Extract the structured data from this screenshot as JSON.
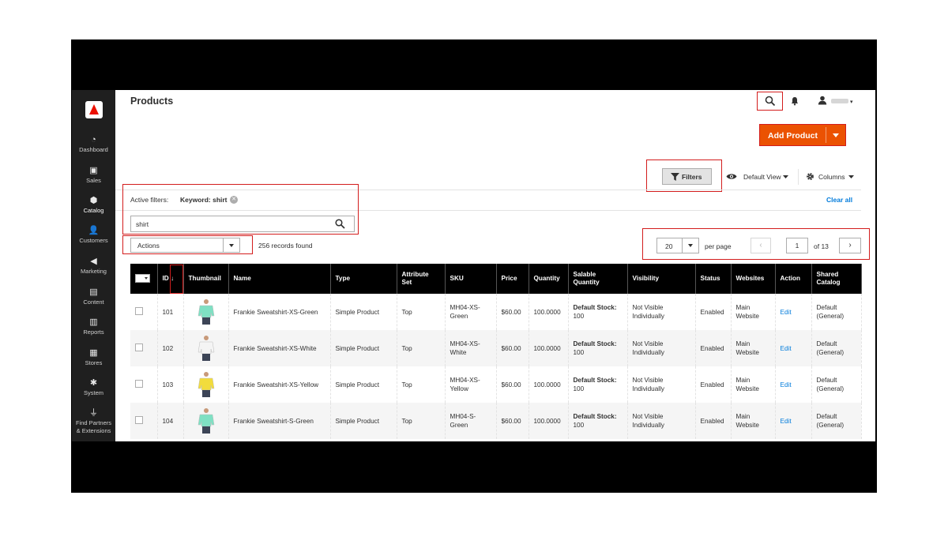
{
  "page": {
    "title": "Products"
  },
  "sidebar": {
    "logo": "adobe-logo",
    "items": [
      {
        "label": "Dashboard",
        "icon": "gauge-icon"
      },
      {
        "label": "Sales",
        "icon": "dollar-icon"
      },
      {
        "label": "Catalog",
        "icon": "cube-icon",
        "active": true
      },
      {
        "label": "Customers",
        "icon": "users-icon"
      },
      {
        "label": "Marketing",
        "icon": "megaphone-icon"
      },
      {
        "label": "Content",
        "icon": "layout-icon"
      },
      {
        "label": "Reports",
        "icon": "bar-chart-icon"
      },
      {
        "label": "Stores",
        "icon": "store-icon"
      },
      {
        "label": "System",
        "icon": "gear-icon"
      },
      {
        "label": "Find Partners\n& Extensions",
        "label_line1": "Find Partners",
        "label_line2": "& Extensions",
        "icon": "plug-icon"
      }
    ]
  },
  "header": {
    "search_icon": "search-icon",
    "notifications_icon": "bell-icon",
    "user_icon": "user-icon"
  },
  "toolbar": {
    "add_product": "Add Product",
    "filters": "Filters",
    "default_view": "Default View",
    "columns": "Columns"
  },
  "active_filters": {
    "label": "Active filters:",
    "keyword": "Keyword: shirt",
    "clear_all": "Clear all"
  },
  "search": {
    "value": "shirt"
  },
  "actions": {
    "selected": "Actions"
  },
  "records_found": "256 records found",
  "pager": {
    "per_page_value": "20",
    "per_page_label": "per page",
    "prev": "‹",
    "page": "1",
    "of_pages": "of 13",
    "next": "›"
  },
  "grid": {
    "columns": [
      "ID",
      "Thumbnail",
      "Name",
      "Type",
      "Attribute Set",
      "SKU",
      "Price",
      "Quantity",
      "Salable Quantity",
      "Visibility",
      "Status",
      "Websites",
      "Action",
      "Shared Catalog"
    ],
    "sort_indicator": "↓",
    "rows": [
      {
        "id": "101",
        "thumb_color": "#7fe0c3",
        "name": "Frankie  Sweatshirt-XS-Green",
        "type": "Simple Product",
        "attribute_set": "Top",
        "sku_1": "MH04-XS-",
        "sku_2": "Green",
        "price": "$60.00",
        "quantity": "100.0000",
        "salable_label": "Default Stock:",
        "salable_value": "100",
        "visibility_1": "Not Visible",
        "visibility_2": "Individually",
        "status": "Enabled",
        "websites_1": "Main",
        "websites_2": "Website",
        "action": "Edit",
        "catalog_1": "Default",
        "catalog_2": "(General)"
      },
      {
        "id": "102",
        "thumb_color": "#f4f4f4",
        "name": "Frankie  Sweatshirt-XS-White",
        "type": "Simple Product",
        "attribute_set": "Top",
        "sku_1": "MH04-XS-",
        "sku_2": "White",
        "price": "$60.00",
        "quantity": "100.0000",
        "salable_label": "Default Stock:",
        "salable_value": "100",
        "visibility_1": "Not Visible",
        "visibility_2": "Individually",
        "status": "Enabled",
        "websites_1": "Main",
        "websites_2": "Website",
        "action": "Edit",
        "catalog_1": "Default",
        "catalog_2": "(General)"
      },
      {
        "id": "103",
        "thumb_color": "#f2dc3c",
        "name": "Frankie  Sweatshirt-XS-Yellow",
        "type": "Simple Product",
        "attribute_set": "Top",
        "sku_1": "MH04-XS-",
        "sku_2": "Yellow",
        "price": "$60.00",
        "quantity": "100.0000",
        "salable_label": "Default Stock:",
        "salable_value": "100",
        "visibility_1": "Not Visible",
        "visibility_2": "Individually",
        "status": "Enabled",
        "websites_1": "Main",
        "websites_2": "Website",
        "action": "Edit",
        "catalog_1": "Default",
        "catalog_2": "(General)"
      },
      {
        "id": "104",
        "thumb_color": "#7fe0c3",
        "name": "Frankie  Sweatshirt-S-Green",
        "type": "Simple Product",
        "attribute_set": "Top",
        "sku_1": "MH04-S-",
        "sku_2": "Green",
        "price": "$60.00",
        "quantity": "100.0000",
        "salable_label": "Default Stock:",
        "salable_value": "100",
        "visibility_1": "Not Visible",
        "visibility_2": "Individually",
        "status": "Enabled",
        "websites_1": "Main",
        "websites_2": "Website",
        "action": "Edit",
        "catalog_1": "Default",
        "catalog_2": "(General)"
      }
    ]
  },
  "colors": {
    "accent": "#eb5202",
    "highlight": "#d31d1d",
    "link": "#007bdb",
    "sidebar": "#1f1f1f"
  }
}
